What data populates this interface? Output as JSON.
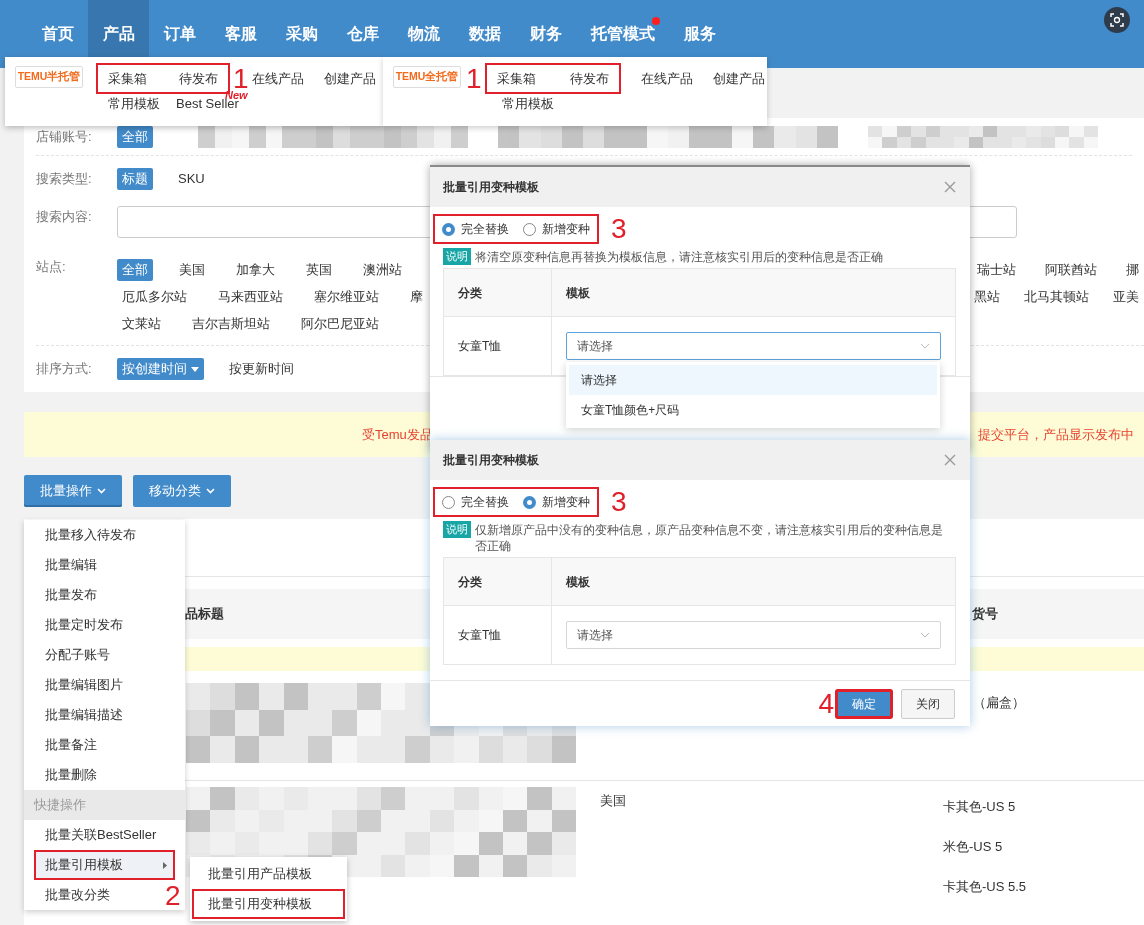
{
  "nav": {
    "items": [
      {
        "label": "首页",
        "selected": false,
        "dot": false
      },
      {
        "label": "产品",
        "selected": true,
        "dot": false
      },
      {
        "label": "订单",
        "selected": false,
        "dot": false
      },
      {
        "label": "客服",
        "selected": false,
        "dot": false
      },
      {
        "label": "采购",
        "selected": false,
        "dot": false
      },
      {
        "label": "仓库",
        "selected": false,
        "dot": false
      },
      {
        "label": "物流",
        "selected": false,
        "dot": false
      },
      {
        "label": "数据",
        "selected": false,
        "dot": false
      },
      {
        "label": "财务",
        "selected": false,
        "dot": false
      },
      {
        "label": "托管模式",
        "selected": false,
        "dot": true
      },
      {
        "label": "服务",
        "selected": false,
        "dot": false
      }
    ]
  },
  "product_menus": [
    {
      "logo": "TEMU半托管",
      "annotation": "1",
      "new_tag": "New",
      "framed_items": [
        "采集箱",
        "待发布"
      ],
      "items": [
        "在线产品",
        "创建产品"
      ],
      "row2": [
        "常用模板",
        "Best Seller"
      ]
    },
    {
      "logo": "TEMU全托管",
      "annotation": "1",
      "framed_items": [
        "采集箱",
        "待发布"
      ],
      "items": [
        "在线产品",
        "创建产品"
      ],
      "row2": [
        "常用模板"
      ]
    }
  ],
  "filters": [
    {
      "kind": "options",
      "label": "店铺账号:",
      "options": [
        {
          "label": "全部",
          "selected": true
        }
      ]
    },
    {
      "kind": "options",
      "label": "搜索类型:",
      "options": [
        {
          "label": "标题",
          "selected": true
        },
        {
          "label": "SKU",
          "selected": false
        }
      ]
    },
    {
      "kind": "input",
      "label": "搜索内容:"
    },
    {
      "kind": "sites",
      "label": "站点:",
      "lines": [
        {
          "left": [
            {
              "label": "全部",
              "selected": true
            },
            {
              "label": "美国",
              "selected": false
            },
            {
              "label": "加拿大",
              "selected": false
            },
            {
              "label": "英国",
              "selected": false
            },
            {
              "label": "澳洲站",
              "selected": false
            }
          ],
          "right": [
            {
              "label": "瑞士站",
              "selected": false
            },
            {
              "label": "阿联酋站",
              "selected": false
            },
            {
              "label": "挪",
              "selected": false
            }
          ]
        },
        {
          "left": [
            {
              "label": "厄瓜多尔站",
              "selected": false
            },
            {
              "label": "马来西亚站",
              "selected": false
            },
            {
              "label": "塞尔维亚站",
              "selected": false
            },
            {
              "label": "摩",
              "selected": false
            }
          ],
          "right": [
            {
              "label": "黑站",
              "selected": false
            },
            {
              "label": "北马其顿站",
              "selected": false
            },
            {
              "label": "亚美",
              "selected": false
            }
          ]
        },
        {
          "left": [
            {
              "label": "文莱站",
              "selected": false
            },
            {
              "label": "吉尔吉斯坦站",
              "selected": false
            },
            {
              "label": "阿尔巴尼亚站",
              "selected": false
            }
          ]
        }
      ]
    },
    {
      "kind": "options",
      "label": "排序方式:",
      "options": [
        {
          "label": "按创建时间",
          "selected": true,
          "caret": true
        },
        {
          "label": "按更新时间",
          "selected": false,
          "caret": false
        }
      ]
    }
  ],
  "notice": {
    "left": "受Temu发品",
    "right": "提交平台，产品显示发布中"
  },
  "toolbar": [
    {
      "label": "批量操作",
      "expanded": true
    },
    {
      "label": "移动分类",
      "expanded": false
    }
  ],
  "batch_menu": [
    {
      "kind": "item",
      "label": "批量移入待发布"
    },
    {
      "kind": "item",
      "label": "批量编辑"
    },
    {
      "kind": "item",
      "label": "批量发布"
    },
    {
      "kind": "item",
      "label": "批量定时发布"
    },
    {
      "kind": "item",
      "label": "分配子账号"
    },
    {
      "kind": "item",
      "label": "批量编辑图片"
    },
    {
      "kind": "item",
      "label": "批量编辑描述"
    },
    {
      "kind": "item",
      "label": "批量备注"
    },
    {
      "kind": "item",
      "label": "批量删除"
    },
    {
      "kind": "header",
      "label": "快捷操作"
    },
    {
      "kind": "item",
      "label": "批量关联BestSeller"
    },
    {
      "kind": "submenu",
      "label": "批量引用模板",
      "expanded": true,
      "framed": true,
      "annotation": "2",
      "children": [
        {
          "label": "批量引用产品模板",
          "framed": false
        },
        {
          "label": "批量引用变种模板",
          "framed": true
        }
      ]
    },
    {
      "kind": "item",
      "label": "批量改分类"
    }
  ],
  "table": {
    "columns": [
      "品标题",
      "货号"
    ],
    "rows": [
      {
        "site": "",
        "code": "（扁盒）",
        "variants": []
      },
      {
        "site": "美国",
        "code": "",
        "variants": [
          "卡其色-US 5",
          "米色-US 5",
          "卡其色-US 5.5"
        ]
      }
    ]
  },
  "dialogs": [
    {
      "title": "批量引用变种模板",
      "annotation": "3",
      "modes": [
        {
          "label": "完全替换",
          "selected": true
        },
        {
          "label": "新增变种",
          "selected": false
        }
      ],
      "note_badge": "说明",
      "note": "将清空原变种信息再替换为模板信息，请注意核实引用后的变种信息是否正确",
      "columns": [
        "分类",
        "模板"
      ],
      "rows": [
        {
          "category": "女童T恤",
          "placeholder": "请选择",
          "focused": true
        }
      ],
      "dropdown": [
        {
          "label": "请选择",
          "selected": true
        },
        {
          "label": "女童T恤颜色+尺码",
          "selected": false
        }
      ]
    },
    {
      "title": "批量引用变种模板",
      "annotation": "3",
      "modes": [
        {
          "label": "完全替换",
          "selected": false
        },
        {
          "label": "新增变种",
          "selected": true
        }
      ],
      "note_badge": "说明",
      "note": "仅新增原产品中没有的变种信息，原产品变种信息不变，请注意核实引用后的变种信息是否正确",
      "columns": [
        "分类",
        "模板"
      ],
      "rows": [
        {
          "category": "女童T恤",
          "placeholder": "请选择",
          "focused": false
        }
      ],
      "buttons": [
        {
          "label": "确定",
          "kind": "primary",
          "annotation": "4"
        },
        {
          "label": "关闭",
          "kind": "default"
        }
      ]
    }
  ]
}
